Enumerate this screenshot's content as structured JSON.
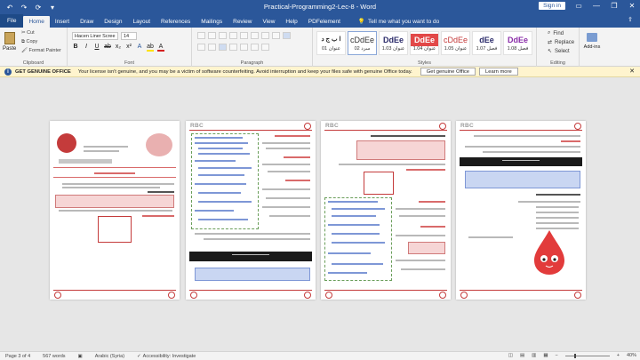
{
  "titlebar": {
    "doc_title": "Practical-Programming2-Lec-8  -  Word",
    "signin": "Sign in",
    "minimize": "—",
    "restore": "❐",
    "close": "✕"
  },
  "tabs": {
    "file": "File",
    "items": [
      "Home",
      "Insert",
      "Draw",
      "Design",
      "Layout",
      "References",
      "Mailings",
      "Review",
      "View",
      "Help",
      "PDFelement"
    ],
    "tellme": "Tell me what you want to do",
    "share_icon": "share-icon"
  },
  "ribbon": {
    "clipboard": {
      "paste": "Paste",
      "cut": "Cut",
      "copy": "Copy",
      "format_painter": "Format Painter",
      "label": "Clipboard"
    },
    "font": {
      "name": "Hacen Liner Scree",
      "size": "14",
      "label": "Font"
    },
    "paragraph": {
      "label": "Paragraph"
    },
    "styles": {
      "label": "Styles",
      "items": [
        {
          "preview": "ا ب ج د",
          "name": "عنوان 01"
        },
        {
          "preview": "cDdEe",
          "name": "سرد 02"
        },
        {
          "preview": "DdEe",
          "name": "عنوان 1.03"
        },
        {
          "preview": "DdEe",
          "name": "عنوان 1.04"
        },
        {
          "preview": "cDdEe",
          "name": "عنوان 1.05"
        },
        {
          "preview": "dEe",
          "name": "فصل 1.07"
        },
        {
          "preview": "DdEe",
          "name": "فصل 1.08"
        }
      ]
    },
    "editing": {
      "find": "Find",
      "replace": "Replace",
      "select": "Select",
      "label": "Editing"
    },
    "addins": {
      "label": "Add-ins"
    }
  },
  "infobar": {
    "title": "GET GENUINE OFFICE",
    "message": "Your license isn't genuine, and you may be a victim of software counterfeiting. Avoid interruption and keep your files safe with genuine Office today.",
    "primary_button": "Get genuine Office",
    "secondary_button": "Learn more"
  },
  "statusbar": {
    "page": "Page 3 of 4",
    "words": "567 words",
    "language": "Arabic (Syria)",
    "accessibility": "Accessibility: Investigate",
    "zoom": "40%",
    "zoom_fraction": 0.4
  },
  "colors": {
    "word_blue": "#2b579a",
    "accent_red": "#c43b3b",
    "info_yellow": "#fff4ce"
  }
}
